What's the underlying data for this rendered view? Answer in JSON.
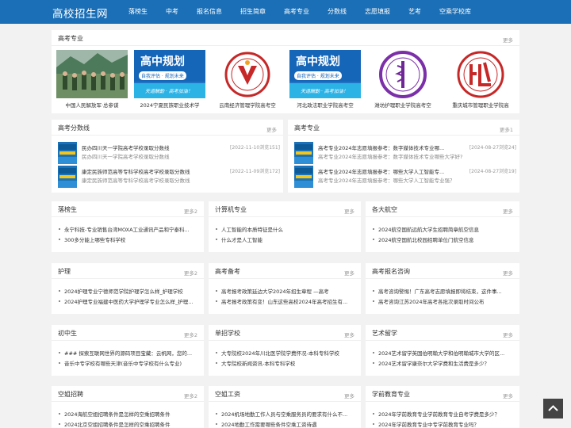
{
  "header": {
    "logo": "高校招生网",
    "nav": [
      "落榜生",
      "中考",
      "报名信息",
      "招生简章",
      "高考专业",
      "分数线",
      "志愿填报",
      "艺考",
      "空乘学校库"
    ]
  },
  "featured": {
    "title": "高考专业",
    "more": "更多",
    "items": [
      {
        "caption": "中国人民解放军·总参谋",
        "image": "military-photo"
      },
      {
        "caption": "2024宁夏民族职业技术学",
        "image": "gaozhong-guihua-banner"
      },
      {
        "caption": "云南经济管理学院高考空",
        "image": "university-seal-red"
      },
      {
        "caption": "河北政法职业学院高考空",
        "image": "gaozhong-guihua-banner"
      },
      {
        "caption": "潍坊护理职业学院高考空",
        "image": "medical-seal-purple"
      },
      {
        "caption": "重庆城市管理职业学院高",
        "image": "city-seal-red"
      }
    ],
    "banner_text": {
      "main": "高中规划",
      "sub": "自我评估 · 规划未来",
      "slogan": "天道酬勤 · 高考加油！"
    }
  },
  "scores": {
    "title": "高考分数线",
    "more": "更多",
    "articles": [
      {
        "title": "民办四川天一学院高考学校录取分数线",
        "meta": "[2022-11-10浏览151]",
        "desc": "民办四川天一学院高考学校录取分数线"
      },
      {
        "title": "康定民族师范高等专科学校高考学校录取分数线",
        "meta": "[2022-11-09浏览172]",
        "desc": "康定民族师范高等专科学校高考学校录取分数线"
      }
    ]
  },
  "majors": {
    "title": "高考专业",
    "more": "更多1",
    "articles": [
      {
        "title": "高考专业2024年志愿填报参考：数字媒体技术专业哪...",
        "meta": "[2024-08-27浏览24]",
        "desc": "高考专业2024年志愿填报参考：数字媒体技术专业哪些大学好?"
      },
      {
        "title": "高考专业2024年志愿填报参考：哪些大学人工智能专...",
        "meta": "[2024-08-27浏览19]",
        "desc": "高考专业2024年志愿填报参考：哪些大学人工智能专业强？"
      }
    ]
  },
  "cards": [
    {
      "title": "落榜生",
      "more": "更多2",
      "items": [
        "永宁科技-专业销售台湾MOXA工业通讯产品和宁泰科...",
        "300多分能上哪些专科学校"
      ]
    },
    {
      "title": "计算机专业",
      "more": "更多",
      "items": [
        "人工智能的本质特征是什么",
        "什么才是人工智能"
      ]
    },
    {
      "title": "各大航空",
      "more": "更多",
      "items": [
        "2024航空国航远航大学生招聘简章航空信息",
        "2024航空国航北校园招聘单位门航空信息"
      ]
    },
    {
      "title": "护理",
      "more": "更多2",
      "items": [
        "2024护理专业宁德师范学院护理学怎么样_护理学校",
        "2024护理专业福建中医药大学护理学专业怎么样_护理..."
      ]
    },
    {
      "title": "高考备考",
      "more": "更多",
      "items": [
        "高考报考政策延边大学2024年招生章程 —高考",
        "高考报考政策有变！山东这些高校2024年高考招生有..."
      ]
    },
    {
      "title": "高考报名咨询",
      "more": "更多",
      "items": [
        "高考咨询警惕！广东高考志愿填报即将结束，这件事...",
        "高考咨询江苏2024年高考各批次录取时间公布"
      ]
    },
    {
      "title": "初中生",
      "more": "更多2",
      "items": [
        "### 探索互联网世界的源码项目宝藏：云帆网，您的...",
        "音乐中专学校有哪些天津(音乐中专学校有什么专业)"
      ]
    },
    {
      "title": "单招学校",
      "more": "更多",
      "items": [
        "大专院校2024年川北医学院学费怀况-本科专科学校",
        "大专院校新闻资讯-本科专科学校"
      ]
    },
    {
      "title": "艺术留学",
      "more": "更多",
      "items": [
        "2024艺术留学英国伯明翰大学和伯明翰城市大学的区...",
        "2024艺术留学康奈尔大学学费和生活费是多少？"
      ]
    },
    {
      "title": "空姐招聘",
      "more": "更多2",
      "items": [
        "2024海航空姐招聘条件是怎样的空乘招聘条件",
        "2024北京空姐招聘条件是怎样的空乘招聘条件"
      ]
    },
    {
      "title": "空姐工资",
      "more": "更多",
      "items": [
        "2024机场地勤工作人员与空乘服务员的要求有什么不...",
        "2024地勤工作需要哪些条件空乘工资待遇"
      ]
    },
    {
      "title": "学前教育专业",
      "more": "更多",
      "items": [
        "2024年学前教育专业学前教育专业自考学费是多少？",
        "2024年学前教育专业中专学前教育专业吗？"
      ]
    }
  ],
  "back_to_top_icon": "chevron-up-icon",
  "colors": {
    "header": "#1b6fb6",
    "background": "#f2f2f2",
    "card": "#ffffff"
  }
}
